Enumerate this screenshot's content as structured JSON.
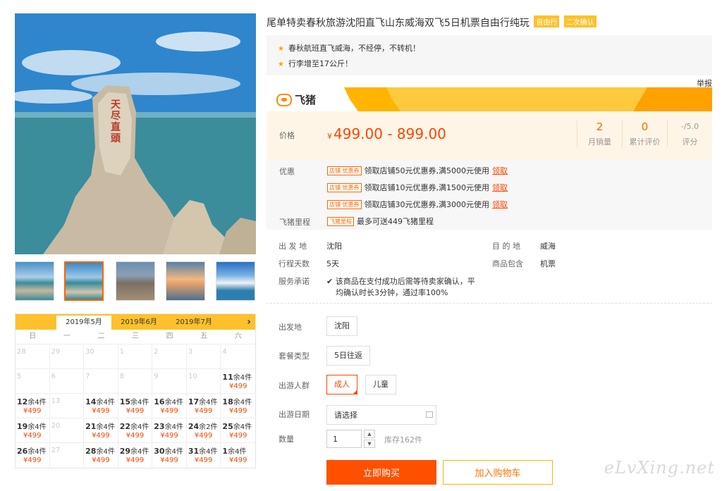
{
  "product": {
    "title": "尾单特卖春秋旅游沈阳直飞山东威海双飞5日机票自由行纯玩",
    "badges": [
      "自由行",
      "二次确认"
    ],
    "highlights": [
      "春秋航班直飞威海，不经停，不转机！",
      "行李增至17公斤！"
    ],
    "report_label": "举报"
  },
  "brand": {
    "name": "飞猪",
    "icon": "fliggy-logo-icon",
    "colors": {
      "stripe": "#ffb400",
      "accent": "#ff8a00"
    }
  },
  "price": {
    "label": "价格",
    "currency": "¥",
    "range": "499.00 - 899.00",
    "stats": [
      {
        "value": "2",
        "label": "月销量"
      },
      {
        "value": "0",
        "label": "累计评价"
      },
      {
        "value": "-/5.0",
        "label": "评分"
      }
    ]
  },
  "promo": {
    "label": "优惠",
    "coupon_tag": "店铺 优惠券",
    "claim_label": "领取",
    "coupons": [
      "领取店铺50元优惠券,满5000元使用",
      "领取店铺10元优惠券,满1500元使用",
      "领取店铺30元优惠券,满3000元使用"
    ],
    "miles_label": "飞猪里程",
    "miles_tag": "飞猪里程",
    "miles_text": "最多可送449飞猪里程"
  },
  "info": {
    "departure_k": "出 发 地",
    "departure_v": "沈阳",
    "destination_k": "目 的 地",
    "destination_v": "威海",
    "days_k": "行程天数",
    "days_v": "5天",
    "includes_k": "商品包含",
    "includes_v": "机票",
    "service_k": "服务承诺",
    "service_v1": "该商品在支付成功后需等待卖家确认，平",
    "service_v2": "均确认时长3分钟，通过率100%"
  },
  "options": {
    "departure_label": "出发地",
    "departure_value": "沈阳",
    "package_label": "套餐类型",
    "package_value": "5日往返",
    "crowd_label": "出游人群",
    "crowd_adult": "成人",
    "crowd_child": "儿童",
    "date_label": "出游日期",
    "date_placeholder": "请选择",
    "qty_label": "数量",
    "qty_value": "1",
    "stock": "库存162件"
  },
  "actions": {
    "buy": "立即购买",
    "cart": "加入购物车"
  },
  "watermark": "eLvXing.net",
  "calendar": {
    "tabs": [
      "2019年5月",
      "2019年6月",
      "2019年7月"
    ],
    "next": "›",
    "weekdays": [
      "日",
      "一",
      "二",
      "三",
      "四",
      "五",
      "六"
    ],
    "cells": [
      {
        "d": "28"
      },
      {
        "d": "29"
      },
      {
        "d": "30"
      },
      {
        "d": "1"
      },
      {
        "d": "2"
      },
      {
        "d": "3"
      },
      {
        "d": "4"
      },
      {
        "d": "5"
      },
      {
        "d": "6"
      },
      {
        "d": "7"
      },
      {
        "d": "8"
      },
      {
        "d": "9"
      },
      {
        "d": "10"
      },
      {
        "d": "11",
        "s": "余4件",
        "p": "¥499"
      },
      {
        "d": "12",
        "s": "余4件",
        "p": "¥499"
      },
      {
        "d": "13"
      },
      {
        "d": "14",
        "s": "余4件",
        "p": "¥499"
      },
      {
        "d": "15",
        "s": "余4件",
        "p": "¥499"
      },
      {
        "d": "16",
        "s": "余4件",
        "p": "¥499"
      },
      {
        "d": "17",
        "s": "余4件",
        "p": "¥499"
      },
      {
        "d": "18",
        "s": "余4件",
        "p": "¥499"
      },
      {
        "d": "19",
        "s": "余4件",
        "p": "¥499"
      },
      {
        "d": "20"
      },
      {
        "d": "21",
        "s": "余4件",
        "p": "¥499"
      },
      {
        "d": "22",
        "s": "余4件",
        "p": "¥499"
      },
      {
        "d": "23",
        "s": "余4件",
        "p": "¥499"
      },
      {
        "d": "24",
        "s": "余2件",
        "p": "¥499"
      },
      {
        "d": "25",
        "s": "余4件",
        "p": "¥499"
      },
      {
        "d": "26",
        "s": "余4件",
        "p": "¥499"
      },
      {
        "d": "27"
      },
      {
        "d": "28",
        "s": "余4件",
        "p": "¥499"
      },
      {
        "d": "29",
        "s": "余4件",
        "p": "¥499"
      },
      {
        "d": "30",
        "s": "余4件",
        "p": "¥499"
      },
      {
        "d": "31",
        "s": "余4件",
        "p": "¥499"
      },
      {
        "d": "1",
        "s": "余4件",
        "p": "¥499"
      }
    ]
  }
}
